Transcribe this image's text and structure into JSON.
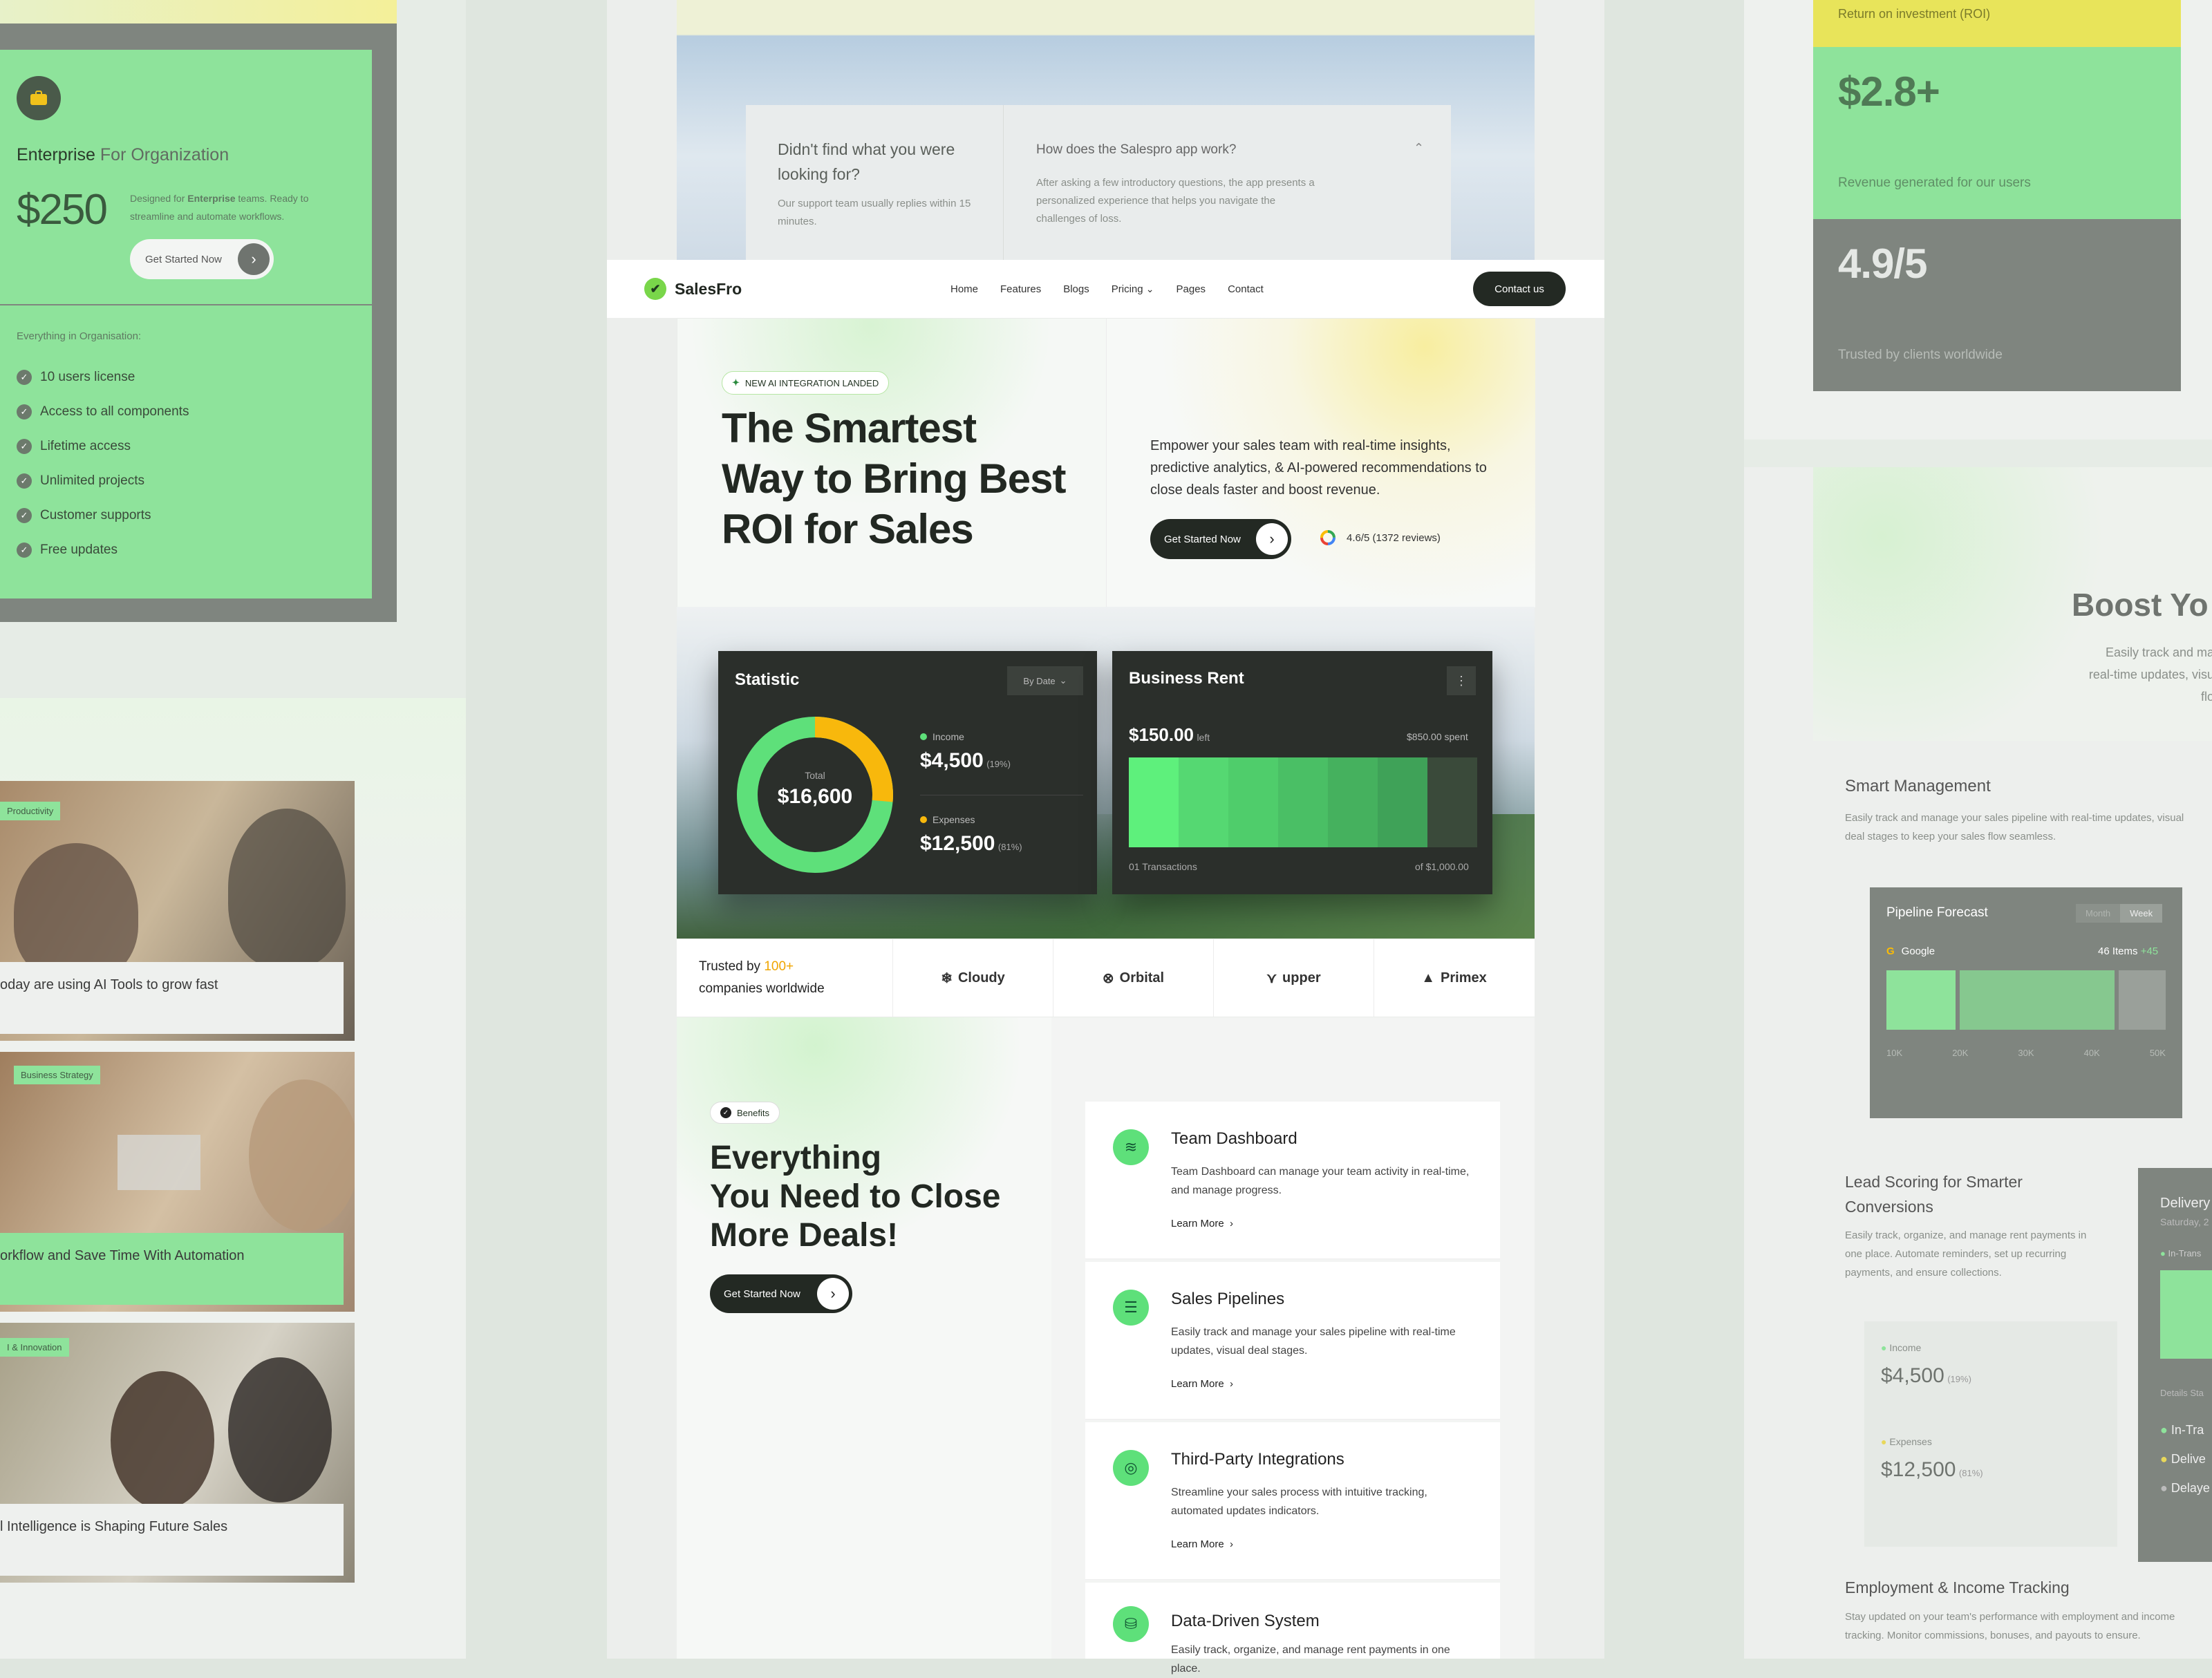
{
  "colors": {
    "accent_green": "#8ee39b",
    "bright_green": "#5ee07a",
    "dark": "#232923",
    "orange": "#f0a500",
    "gold": "#f8b80c"
  },
  "left": {
    "pricing": {
      "icon": "briefcase-icon",
      "plan_name": "Enterprise",
      "plan_suffix": "For Organization",
      "price": "$250",
      "desc_pre": "Designed for ",
      "desc_bold": "Enterprise",
      "desc_post": " teams. Ready to streamline and automate workflows.",
      "cta": "Get Started Now",
      "features_header": "Everything in Organisation:",
      "features": [
        "10 users license",
        "Access to all components",
        "Lifetime access",
        "Unlimited projects",
        "Customer supports",
        "Free updates"
      ]
    },
    "blogs": [
      {
        "tag": "Productivity",
        "title": "oday are using AI Tools to grow fast"
      },
      {
        "tag": "Business Strategy",
        "title": "orkflow and Save Time With Automation"
      },
      {
        "tag": "I & Innovation",
        "title": "l Intelligence is Shaping Future Sales"
      }
    ]
  },
  "faq": {
    "left_title": "Didn't find what you were looking for?",
    "left_sub": "Our support team usually replies within 15 minutes.",
    "question": "How does the Salespro app work?",
    "answer": "After asking a few introductory questions, the app presents a personalized experience that helps you navigate the challenges of loss."
  },
  "nav": {
    "brand": "SalesFro",
    "items": [
      "Home",
      "Features",
      "Blogs",
      "Pricing",
      "Pages",
      "Contact"
    ],
    "pricing_caret": "⌄",
    "cta": "Contact us"
  },
  "hero": {
    "badge": "NEW AI INTEGRATION LANDED",
    "title_lines": [
      "The Smartest",
      "Way to Bring Best",
      "ROI for Sales"
    ],
    "subtitle": "Empower your sales team with real-time insights, predictive analytics, & AI-powered recommendations to close deals faster and boost revenue.",
    "cta": "Get Started Now",
    "rating": "4.6/5 (1372 reviews)"
  },
  "statistic": {
    "title": "Statistic",
    "filter": "By Date",
    "total_label": "Total",
    "total": "$16,600",
    "income_label": "Income",
    "income": "$4,500",
    "income_pct": "(19%)",
    "expenses_label": "Expenses",
    "expenses": "$12,500",
    "expenses_pct": "(81%)"
  },
  "chart_data": {
    "type": "pie",
    "categories": [
      "Income",
      "Expenses"
    ],
    "values": [
      4500,
      12500
    ],
    "title": "Statistic"
  },
  "business_rent": {
    "title": "Business Rent",
    "amount": "$150.00",
    "amount_suffix": "left",
    "spent": "$850.00 spent",
    "transactions": "01 Transactions",
    "of_total": "of $1,000.00",
    "progress": 0.85
  },
  "trusted": {
    "pre": "Trusted by ",
    "count": "100+",
    "post": "companies worldwide",
    "logos": [
      {
        "name": "Cloudy",
        "icon": "snowflake-icon"
      },
      {
        "name": "Orbital",
        "icon": "orbit-icon"
      },
      {
        "name": "upper",
        "icon": "upper-logo-icon"
      },
      {
        "name": "Primex",
        "icon": "primex-logo-icon"
      }
    ]
  },
  "benefits": {
    "badge": "Benefits",
    "title_lines": [
      "Everything",
      "You Need to Close",
      "More Deals!"
    ],
    "cta": "Get Started Now",
    "features": [
      {
        "icon": "layers-icon",
        "title": "Team Dashboard",
        "desc": "Team Dashboard can manage your team activity in real-time, and manage progress.",
        "link": "Learn More"
      },
      {
        "icon": "list-icon",
        "title": "Sales Pipelines",
        "desc": "Easily track and manage your sales pipeline with real-time updates, visual deal stages.",
        "link": "Learn More"
      },
      {
        "icon": "target-icon",
        "title": "Third-Party Integrations",
        "desc": "Streamline your sales process with intuitive tracking, automated updates indicators.",
        "link": "Learn More"
      },
      {
        "icon": "database-icon",
        "title": "Data-Driven System",
        "desc": "Easily track, organize, and manage rent payments in one place.",
        "link": "Learn More"
      }
    ]
  },
  "right": {
    "roi_label": "Return on investment (ROI)",
    "stat1": {
      "value": "$2.8+",
      "label": "Revenue generated for our users"
    },
    "stat2": {
      "value": "4.9/5",
      "label": "Trusted by clients worldwide"
    },
    "boost_title": "Boost Yo",
    "boost_lines": [
      "Easily track and ma",
      "real-time updates, visu",
      "flo"
    ],
    "smart_title": "Smart Management",
    "smart_desc": "Easily track and manage your sales pipeline with real-time updates, visual deal stages to keep your sales flow seamless.",
    "pipeline": {
      "title": "Pipeline Forecast",
      "tabs": [
        "Month",
        "Week"
      ],
      "source": "Google",
      "items": "46 Items",
      "delta": "+45",
      "ticks": [
        "10K",
        "20K",
        "30K",
        "40K",
        "50K"
      ]
    },
    "lead_title": "Lead Scoring for Smarter Conversions",
    "lead_desc": "Easily track, organize, and manage rent payments in one place. Automate reminders, set up recurring payments, and ensure collections.",
    "income_label": "Income",
    "income": "$4,500",
    "income_pct": "(19%)",
    "expenses_label": "Expenses",
    "expenses": "$12,500",
    "expenses_pct": "(81%)",
    "delivery": {
      "title": "Delivery",
      "date": "Saturday, 2",
      "status_small": "In-Trans",
      "details": "Details Sta",
      "items": [
        "In-Tra",
        "Delive",
        "Delaye"
      ]
    },
    "employment_title": "Employment & Income Tracking",
    "employment_desc": "Stay updated on your team's performance with employment and income tracking. Monitor commissions, bonuses, and payouts to ensure."
  }
}
